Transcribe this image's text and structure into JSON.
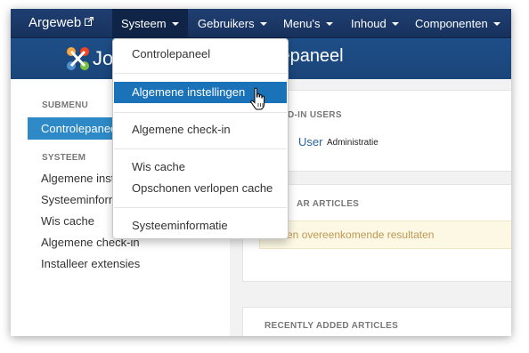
{
  "navbar": {
    "brand": "Argeweb",
    "items": [
      {
        "label": "Systeem"
      },
      {
        "label": "Gebruikers"
      },
      {
        "label": "Menu's"
      },
      {
        "label": "Inhoud"
      },
      {
        "label": "Componenten"
      }
    ]
  },
  "header": {
    "logo_text": "Jo",
    "page_title": "lepaneel"
  },
  "sidebar": {
    "submenu_heading": "SUBMENU",
    "active_item": "Controlepaneel",
    "system_heading": "SYSTEEM",
    "items": [
      {
        "label": "Algemene inst"
      },
      {
        "label": "Systeeminform"
      },
      {
        "label": "Wis cache"
      },
      {
        "label": "Algemene check-in"
      },
      {
        "label": "Installeer extensies"
      }
    ]
  },
  "panels": {
    "logged_users_title": "D-IN USERS",
    "user_name": "User",
    "user_role": "Administratie",
    "popular_title": "AR ARTICLES",
    "no_results": "Geen overeenkomende resultaten",
    "recent_title": "RECENTLY ADDED ARTICLES"
  },
  "dropdown": {
    "items": [
      {
        "label": "Controlepaneel"
      },
      {
        "label": "Algemene instellingen"
      },
      {
        "label": "Algemene check-in"
      },
      {
        "label": "Wis cache"
      },
      {
        "label": "Opschonen verlopen cache"
      },
      {
        "label": "Systeeminformatie"
      }
    ]
  },
  "colors": {
    "navbar": "#1a3867",
    "header": "#1e4e88",
    "accent": "#2d8ac7",
    "dropdown_hover": "#1a73b8",
    "alert_bg": "#fcf8e3"
  }
}
